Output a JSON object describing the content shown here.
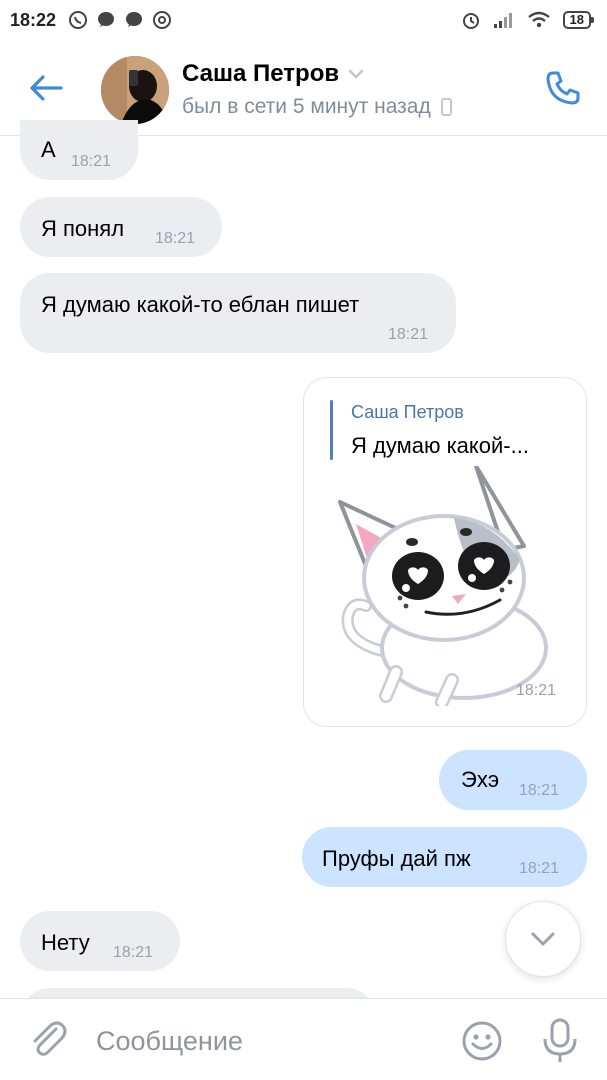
{
  "status_bar": {
    "time": "18:22",
    "battery": "18",
    "left_icons": [
      "whatsapp-icon",
      "chat-icon",
      "chat-icon",
      "at-icon"
    ],
    "right_icons": [
      "alarm-icon",
      "signal-icon",
      "wifi-icon",
      "battery-icon"
    ]
  },
  "header": {
    "contact_name": "Саша Петров",
    "last_seen": "был в сети 5 минут назад"
  },
  "messages": [
    {
      "direction": "in",
      "text": "А",
      "time": "18:21"
    },
    {
      "direction": "in",
      "text": "Я понял",
      "time": "18:21"
    },
    {
      "direction": "in",
      "text": "Я думаю какой-то еблан пишет",
      "time": "18:21"
    },
    {
      "direction": "out",
      "type": "sticker",
      "reply_author": "Саша Петров",
      "reply_text": "Я думаю какой-...",
      "time": "18:21"
    },
    {
      "direction": "out",
      "text": "Эхэ",
      "time": "18:21"
    },
    {
      "direction": "out",
      "text": "Пруфы дай пж",
      "time": "18:21"
    },
    {
      "direction": "in",
      "text": "Нету",
      "time": "18:21"
    }
  ],
  "composer": {
    "placeholder": "Сообщение"
  },
  "colors": {
    "accent": "#4a76a8",
    "incoming_bubble": "#ebedf0",
    "outgoing_bubble": "#cce4ff"
  }
}
